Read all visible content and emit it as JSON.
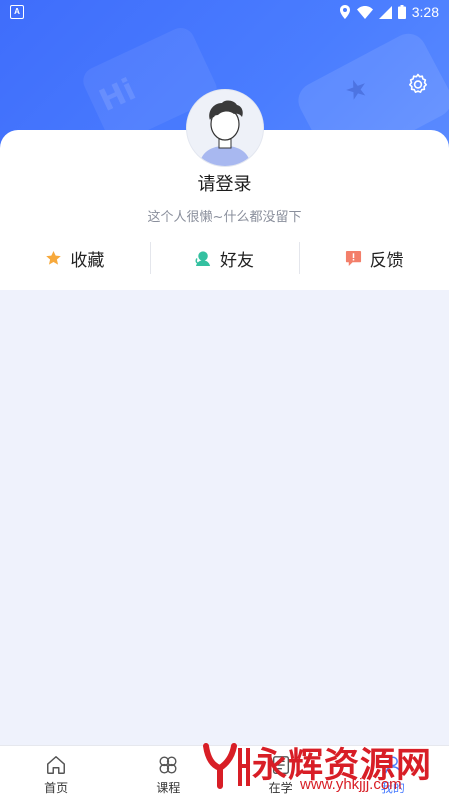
{
  "status_bar": {
    "app_glyph": "A",
    "time": "3:28"
  },
  "header": {
    "decor_text": "Hi"
  },
  "profile": {
    "login_label": "请登录",
    "bio": "这个人很懒~什么都没留下"
  },
  "actions": [
    {
      "label": "收藏",
      "icon": "star-icon",
      "color": "#f7a93c"
    },
    {
      "label": "好友",
      "icon": "friends-icon",
      "color": "#34c0a0"
    },
    {
      "label": "反馈",
      "icon": "feedback-icon",
      "color": "#f37f6a"
    }
  ],
  "tabbar": {
    "tabs": [
      {
        "label": "首页",
        "icon": "home-icon"
      },
      {
        "label": "课程",
        "icon": "course-icon"
      },
      {
        "label": "在学",
        "icon": "study-icon"
      },
      {
        "label": "我的",
        "icon": "profile-icon",
        "active": true
      }
    ]
  },
  "watermark": {
    "text": "永辉资源网",
    "url": "www.yhkjjj.com",
    "color": "#d81e26"
  },
  "colors": {
    "primary": "#4a7dff",
    "background": "#eff2fc"
  }
}
